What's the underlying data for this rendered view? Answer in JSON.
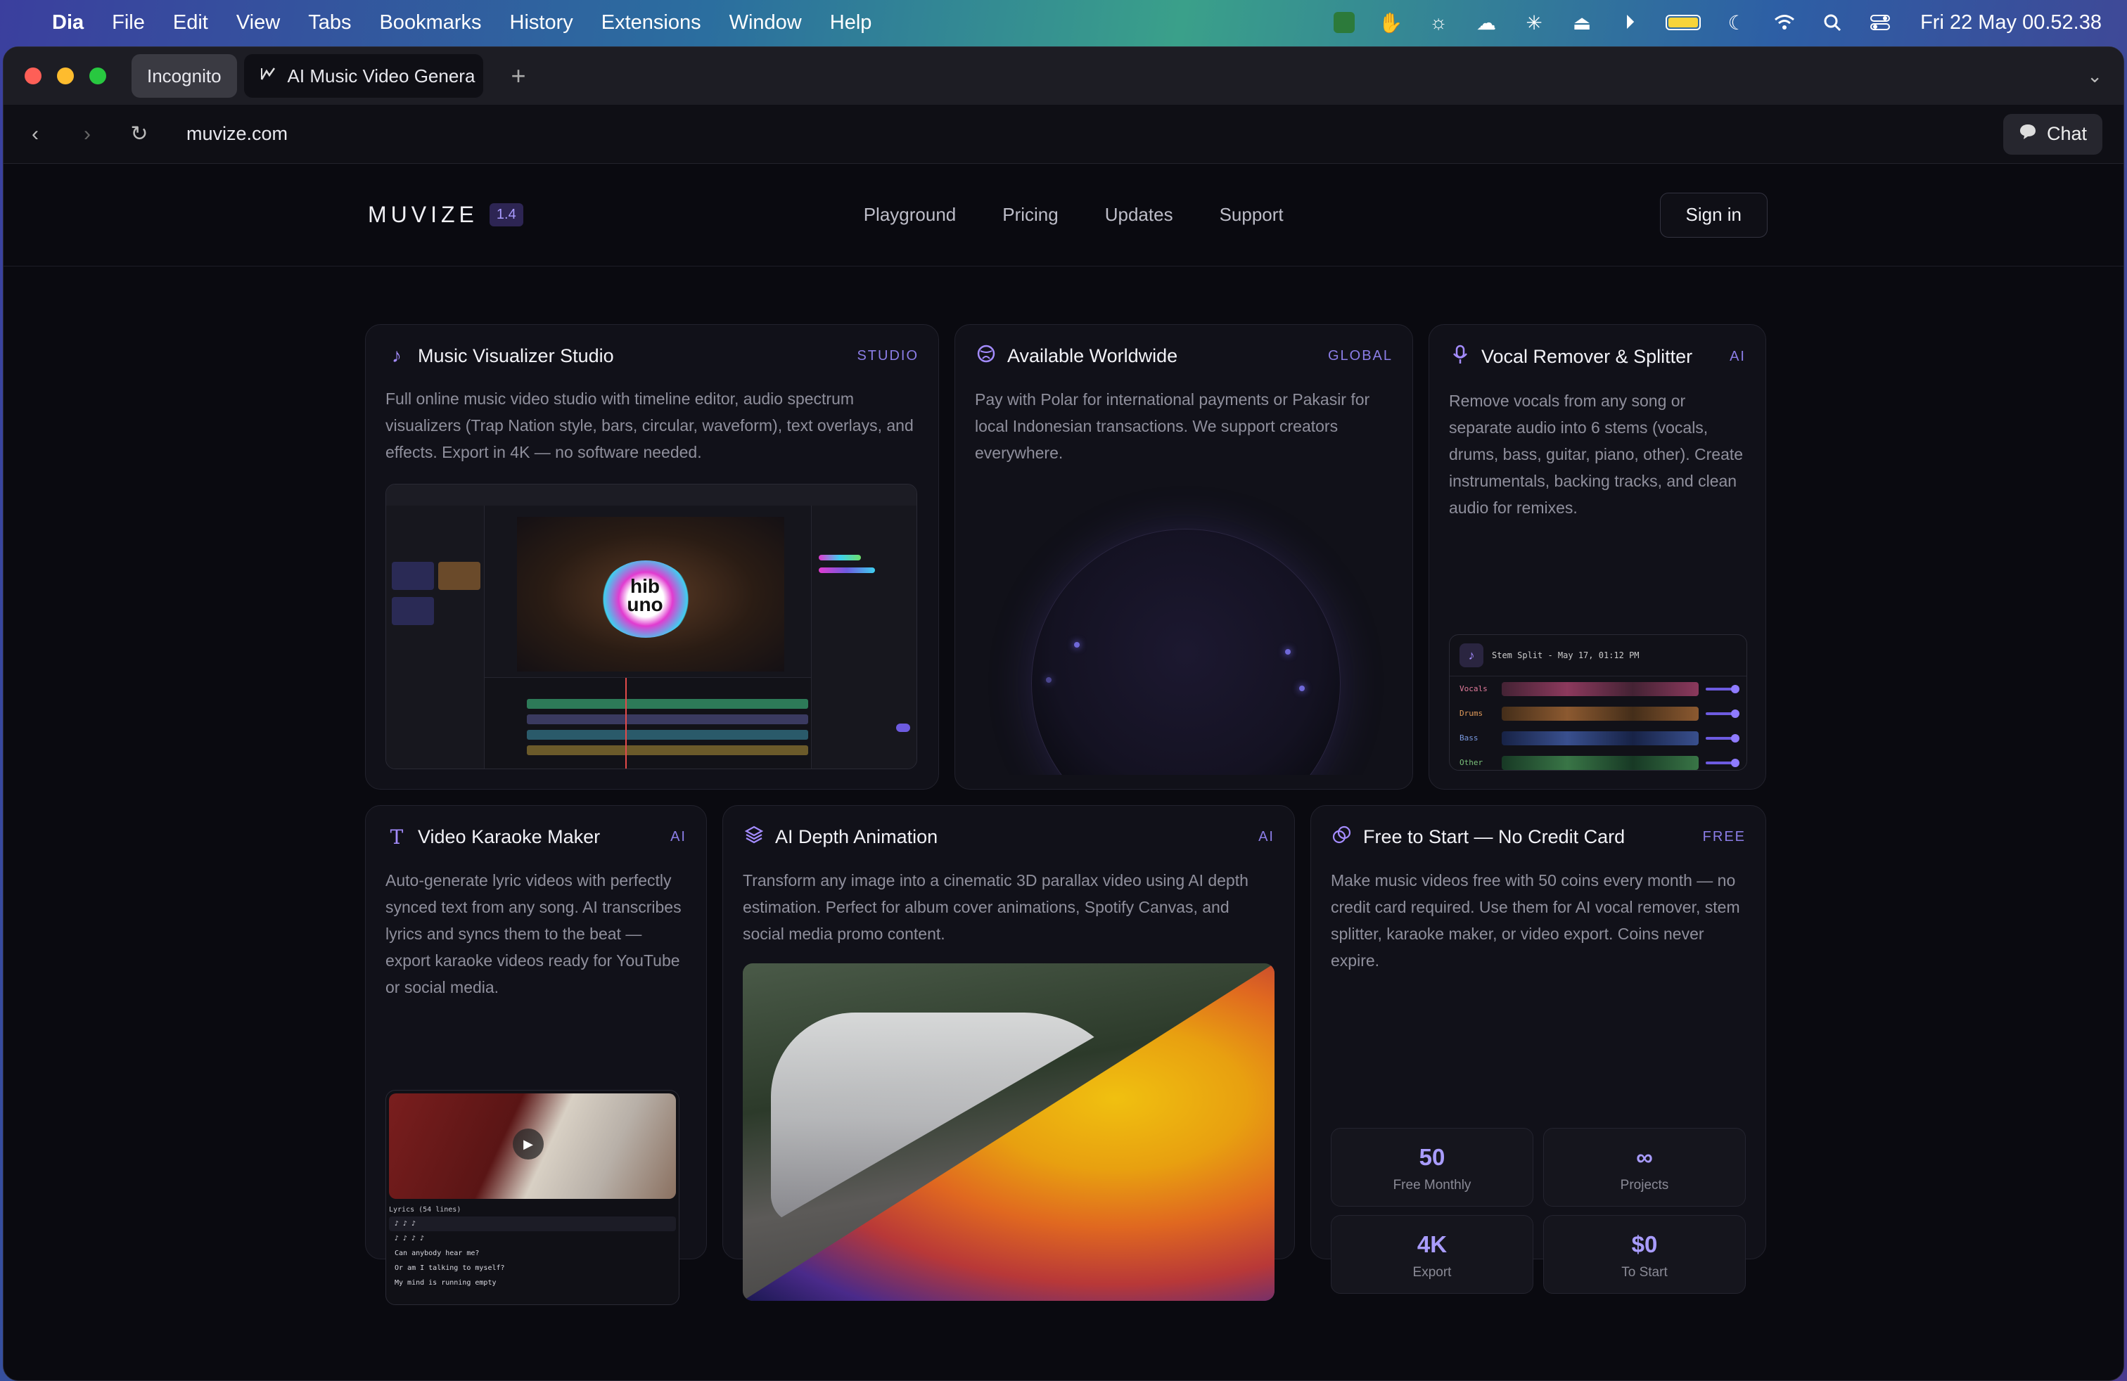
{
  "menubar": {
    "app": "Dia",
    "items": [
      "File",
      "Edit",
      "View",
      "Tabs",
      "Bookmarks",
      "History",
      "Extensions",
      "Window",
      "Help"
    ],
    "clock": "Fri 22 May  00.52.38"
  },
  "browser": {
    "tabs": [
      {
        "label": "Incognito"
      },
      {
        "label": "AI Music Video Genera"
      }
    ],
    "url": "muvize.com",
    "chat_label": "Chat"
  },
  "site": {
    "logo": "MUVIZE",
    "version": "1.4",
    "nav": [
      "Playground",
      "Pricing",
      "Updates",
      "Support"
    ],
    "signin": "Sign in"
  },
  "cards": {
    "studio": {
      "title": "Music Visualizer Studio",
      "tag": "STUDIO",
      "desc": "Full online music video studio with timeline editor, audio spectrum visualizers (Trap Nation style, bars, circular, waveform), text overlays, and effects. Export in 4K — no software needed.",
      "logo_text": "hib uno"
    },
    "worldwide": {
      "title": "Available Worldwide",
      "tag": "GLOBAL",
      "desc": "Pay with Polar for international payments or Pakasir for local Indonesian transactions. We support creators everywhere."
    },
    "vocal": {
      "title": "Vocal Remover & Splitter",
      "tag": "AI",
      "desc": "Remove vocals from any song or separate audio into 6 stems (vocals, drums, bass, guitar, piano, other). Create instrumentals, backing tracks, and clean audio for remixes.",
      "stem_title": "Stem Split - May 17, 01:12 PM",
      "stems": [
        "Vocals",
        "Drums",
        "Bass",
        "Other"
      ]
    },
    "karaoke": {
      "title": "Video Karaoke Maker",
      "tag": "AI",
      "desc": "Auto-generate lyric videos with perfectly synced text from any song. AI transcribes lyrics and syncs them to the beat — export karaoke videos ready for YouTube or social media.",
      "lyrics_head": "Lyrics (54 lines)",
      "lyrics": [
        "♪ ♪ ♪",
        "♪ ♪ ♪ ♪",
        "Can anybody hear me?",
        "Or am I talking to myself?",
        "My mind is running empty"
      ]
    },
    "depth": {
      "title": "AI Depth Animation",
      "tag": "AI",
      "desc": "Transform any image into a cinematic 3D parallax video using AI depth estimation. Perfect for album cover animations, Spotify Canvas, and social media promo content."
    },
    "free": {
      "title": "Free to Start — No Credit Card",
      "tag": "FREE",
      "desc": "Make music videos free with 50 coins every month — no credit card required. Use them for AI vocal remover, stem splitter, karaoke maker, or video export. Coins never expire.",
      "stats": [
        {
          "value": "50",
          "label": "Free Monthly"
        },
        {
          "value": "∞",
          "label": "Projects"
        },
        {
          "value": "4K",
          "label": "Export"
        },
        {
          "value": "$0",
          "label": "To Start"
        }
      ]
    }
  },
  "colors": {
    "accent": "#a99cff",
    "card_bg": "#111119",
    "page_bg": "#0a0a10"
  }
}
